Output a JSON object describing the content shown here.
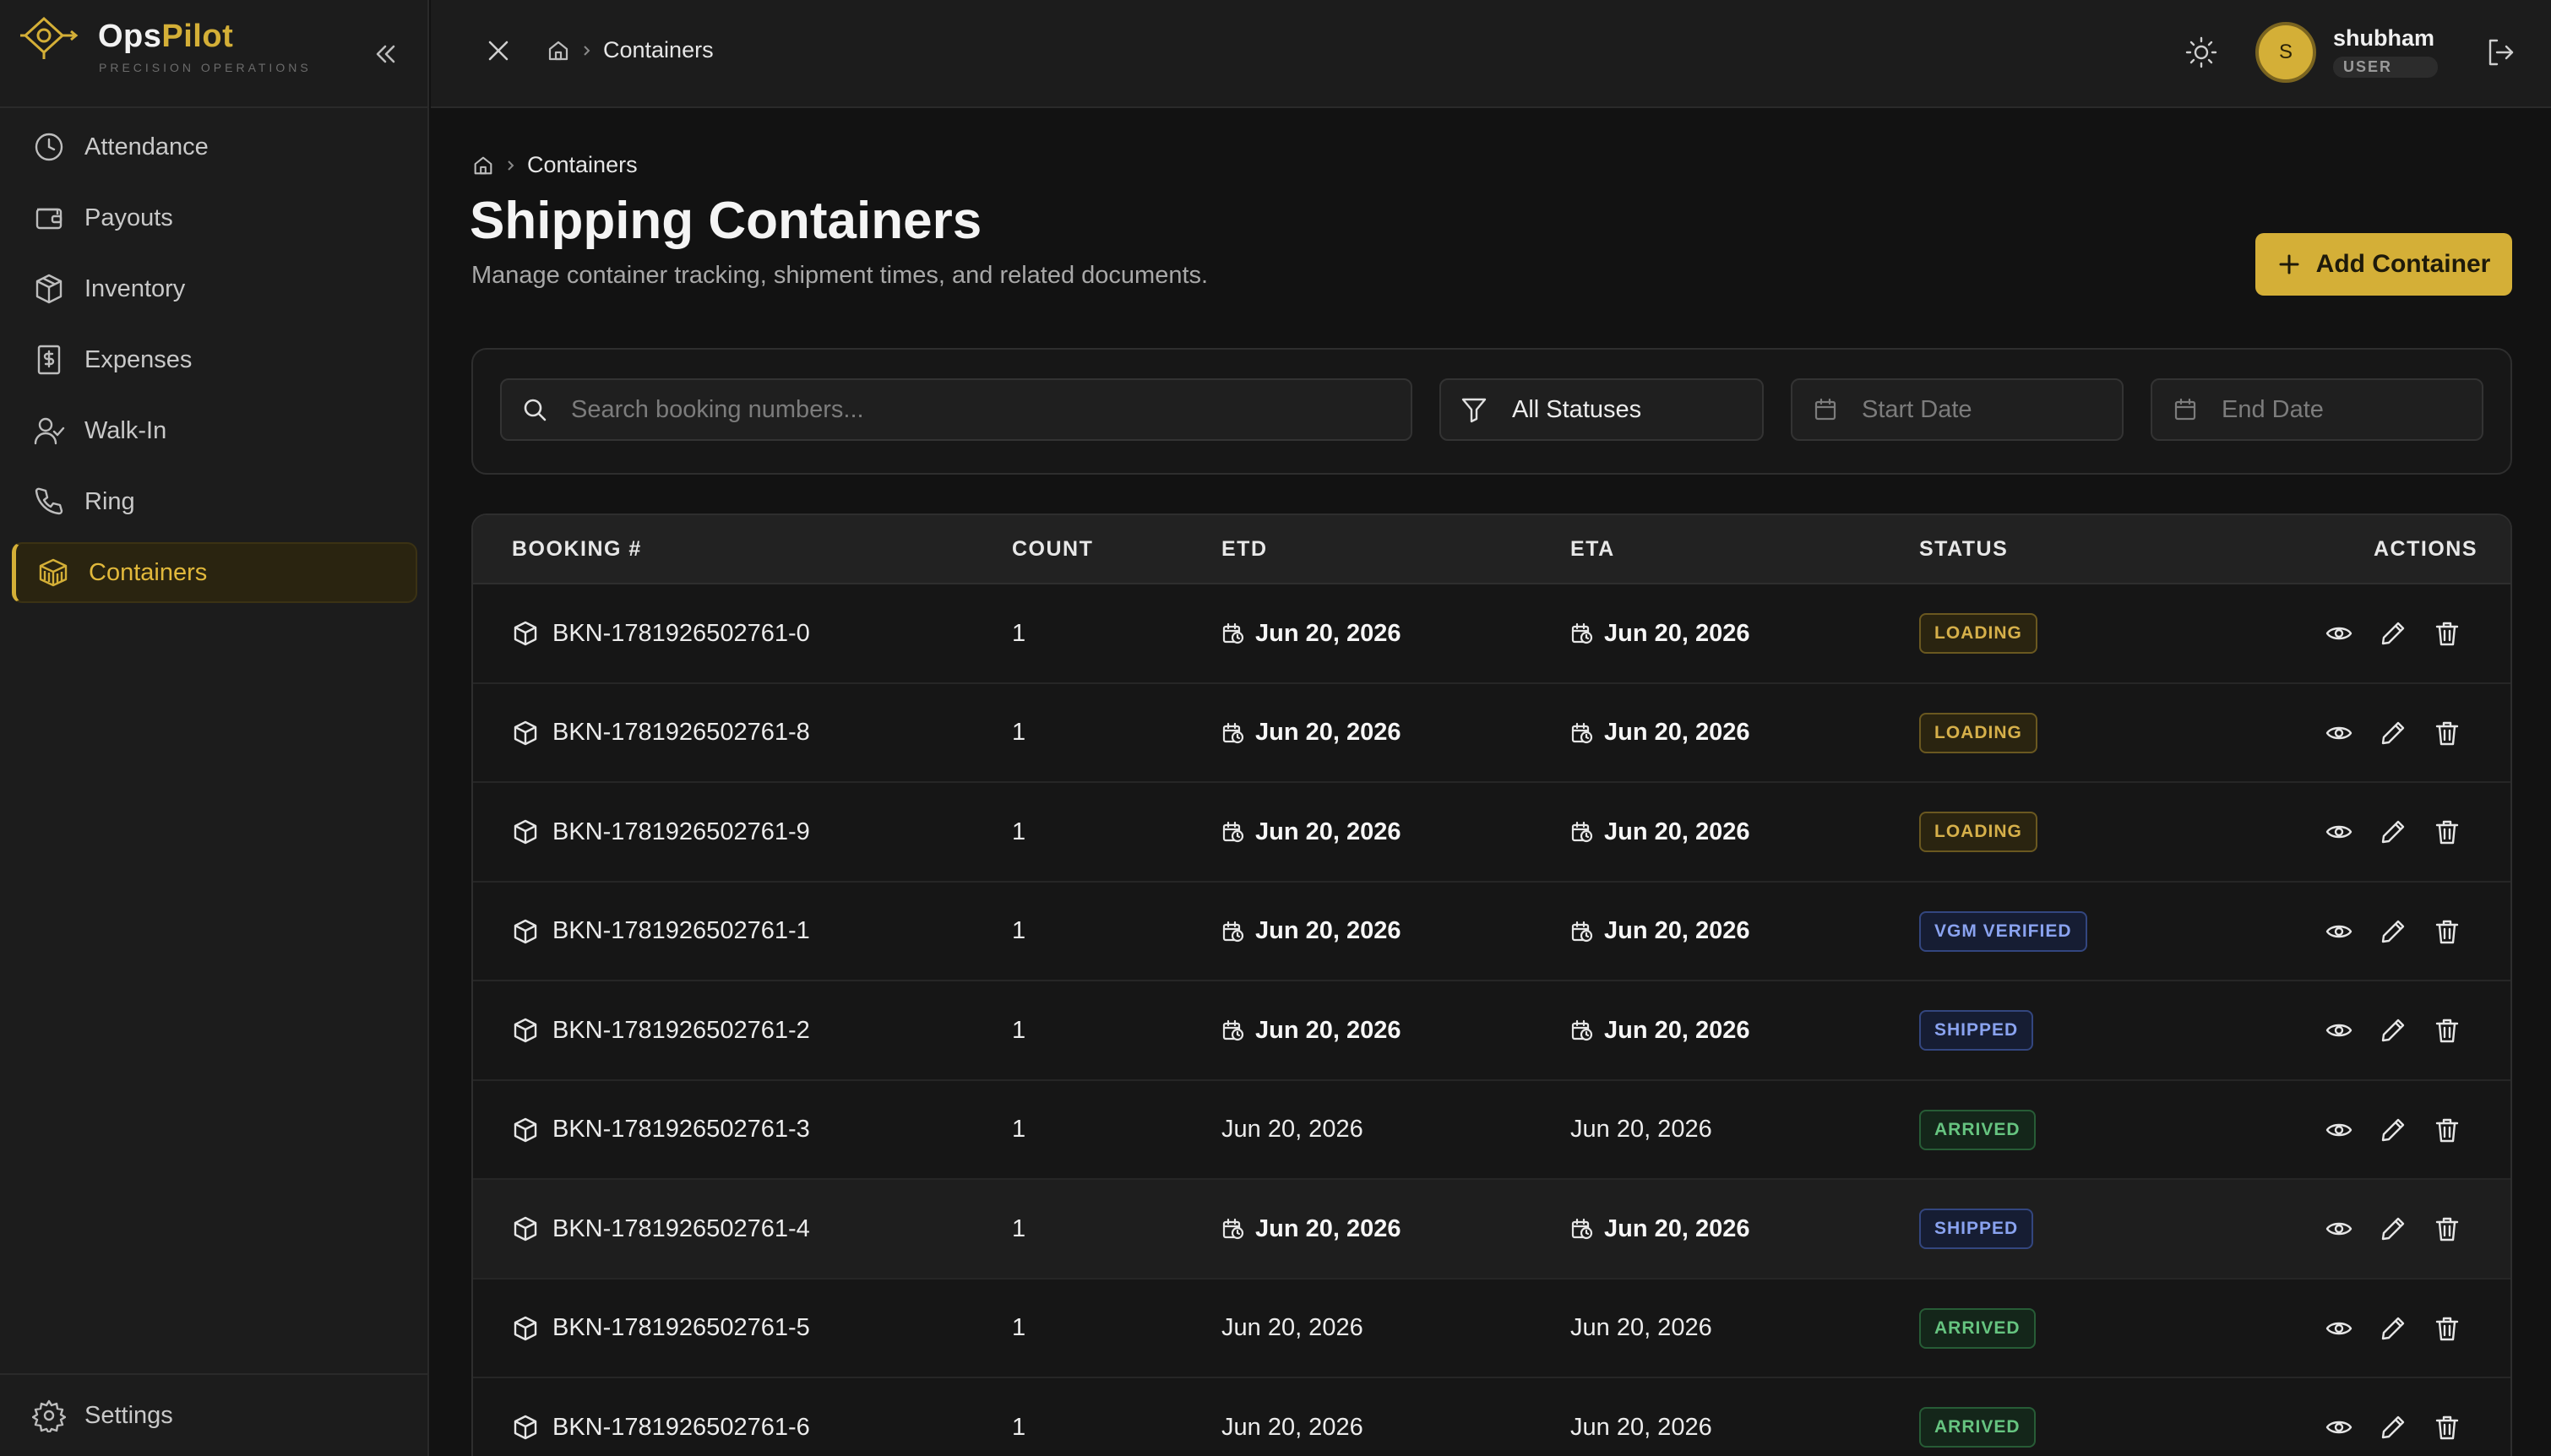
{
  "brand": {
    "name_part1": "Ops",
    "name_part2": "Pilot",
    "tagline": "PRECISION OPERATIONS"
  },
  "sidebar": {
    "items": [
      {
        "label": "Attendance",
        "icon": "clock-icon"
      },
      {
        "label": "Payouts",
        "icon": "wallet-icon"
      },
      {
        "label": "Inventory",
        "icon": "package-icon"
      },
      {
        "label": "Expenses",
        "icon": "receipt-dollar-icon"
      },
      {
        "label": "Walk-In",
        "icon": "user-check-icon"
      },
      {
        "label": "Ring",
        "icon": "phone-icon"
      },
      {
        "label": "Containers",
        "icon": "container-box-icon",
        "active": true
      }
    ],
    "footer": {
      "label": "Settings",
      "icon": "gear-icon"
    }
  },
  "topbar": {
    "breadcrumb": "Containers",
    "user": {
      "initial": "S",
      "name": "shubham",
      "role": "USER"
    }
  },
  "page": {
    "breadcrumb": "Containers",
    "title": "Shipping Containers",
    "subtitle": "Manage container tracking, shipment times, and related documents.",
    "add_button": "Add Container"
  },
  "filters": {
    "search_placeholder": "Search booking numbers...",
    "status_value": "All Statuses",
    "start_date_placeholder": "Start Date",
    "end_date_placeholder": "End Date"
  },
  "table": {
    "headers": {
      "booking": "BOOKING #",
      "count": "COUNT",
      "etd": "ETD",
      "eta": "ETA",
      "status": "STATUS",
      "actions": "ACTIONS"
    },
    "rows": [
      {
        "booking": "BKN-1781926502761-0",
        "count": "1",
        "etd": "Jun 20, 2026",
        "eta": "Jun 20, 2026",
        "status": "LOADING"
      },
      {
        "booking": "BKN-1781926502761-8",
        "count": "1",
        "etd": "Jun 20, 2026",
        "eta": "Jun 20, 2026",
        "status": "LOADING"
      },
      {
        "booking": "BKN-1781926502761-9",
        "count": "1",
        "etd": "Jun 20, 2026",
        "eta": "Jun 20, 2026",
        "status": "LOADING"
      },
      {
        "booking": "BKN-1781926502761-1",
        "count": "1",
        "etd": "Jun 20, 2026",
        "eta": "Jun 20, 2026",
        "status": "VGM VERIFIED"
      },
      {
        "booking": "BKN-1781926502761-2",
        "count": "1",
        "etd": "Jun 20, 2026",
        "eta": "Jun 20, 2026",
        "status": "SHIPPED"
      },
      {
        "booking": "BKN-1781926502761-3",
        "count": "1",
        "etd": "Jun 20, 2026",
        "eta": "Jun 20, 2026",
        "status": "ARRIVED"
      },
      {
        "booking": "BKN-1781926502761-4",
        "count": "1",
        "etd": "Jun 20, 2026",
        "eta": "Jun 20, 2026",
        "status": "SHIPPED"
      },
      {
        "booking": "BKN-1781926502761-5",
        "count": "1",
        "etd": "Jun 20, 2026",
        "eta": "Jun 20, 2026",
        "status": "ARRIVED"
      },
      {
        "booking": "BKN-1781926502761-6",
        "count": "1",
        "etd": "Jun 20, 2026",
        "eta": "Jun 20, 2026",
        "status": "ARRIVED"
      }
    ]
  },
  "colors": {
    "accent": "#d4af37",
    "background": "#121212",
    "sidebar": "#1c1c1c"
  }
}
